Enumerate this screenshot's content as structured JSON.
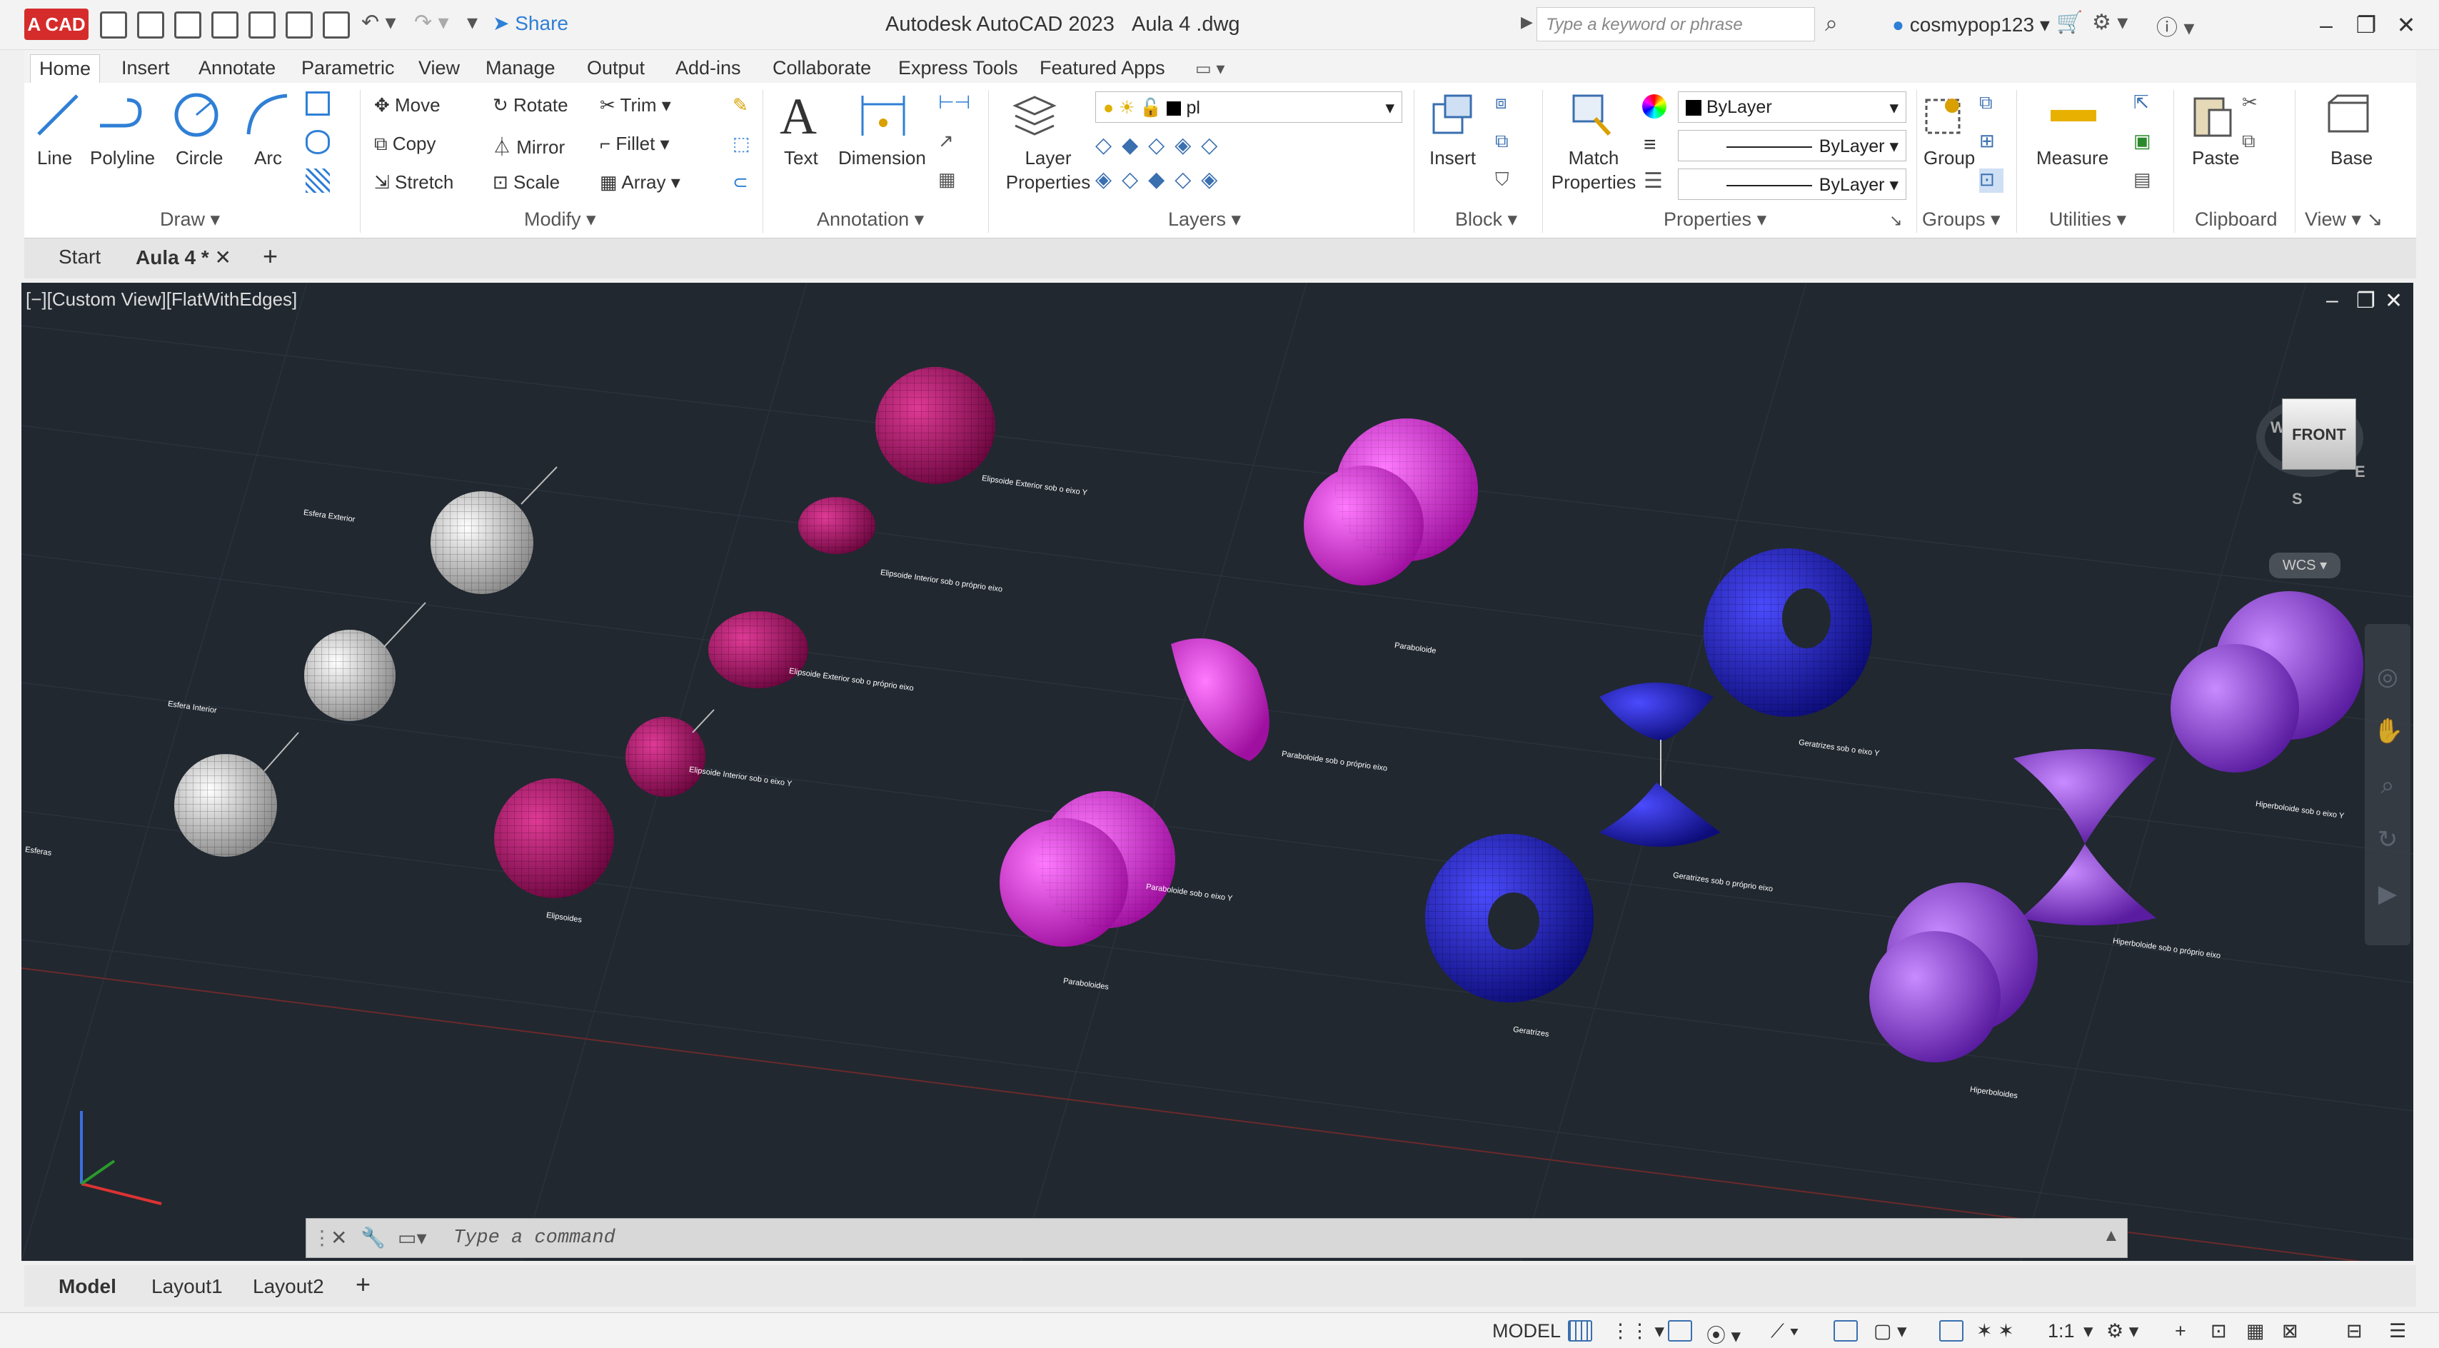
{
  "titlebar": {
    "logo": "A CAD",
    "share": "Share",
    "app_title": "Autodesk AutoCAD 2023",
    "doc_title": "Aula 4 .dwg",
    "search_placeholder": "Type a keyword or phrase",
    "user": "cosmypop123"
  },
  "ribbon_tabs": [
    "Home",
    "Insert",
    "Annotate",
    "Parametric",
    "View",
    "Manage",
    "Output",
    "Add-ins",
    "Collaborate",
    "Express Tools",
    "Featured Apps"
  ],
  "ribbon": {
    "draw": {
      "title": "Draw",
      "line": "Line",
      "polyline": "Polyline",
      "circle": "Circle",
      "arc": "Arc"
    },
    "modify": {
      "title": "Modify",
      "move": "Move",
      "rotate": "Rotate",
      "trim": "Trim",
      "copy": "Copy",
      "mirror": "Mirror",
      "fillet": "Fillet",
      "stretch": "Stretch",
      "scale": "Scale",
      "array": "Array"
    },
    "annotation": {
      "title": "Annotation",
      "text": "Text",
      "dimension": "Dimension"
    },
    "layers": {
      "title": "Layers",
      "layer_properties": "Layer Properties",
      "layer_value": "pl"
    },
    "block": {
      "title": "Block",
      "insert": "Insert"
    },
    "properties": {
      "title": "Properties",
      "match": "Match Properties",
      "color": "ByLayer",
      "linetype": "ByLayer",
      "lineweight": "ByLayer"
    },
    "groups": {
      "title": "Groups",
      "group": "Group"
    },
    "utilities": {
      "title": "Utilities",
      "measure": "Measure"
    },
    "clipboard": {
      "title": "Clipboard",
      "paste": "Paste"
    },
    "view": {
      "title": "View",
      "base": "Base"
    }
  },
  "doc_tabs": {
    "start": "Start",
    "active": "Aula 4 *"
  },
  "viewport": {
    "label": "[−][Custom View][FlatWithEdges]",
    "viewcube": "FRONT",
    "wcs": "WCS",
    "compass_w": "W",
    "compass_e": "E",
    "compass_s": "S",
    "labels": {
      "esfera_exterior": "Esfera Exterior",
      "esfera_interior": "Esfera Interior",
      "esferas": "Esferas",
      "elipsoide_ext_y": "Elipsoide Exterior sob o eixo Y",
      "elipsoide_int_plano": "Elipsoide Interior sob o próprio eixo",
      "elipsoide_ext_plano": "Elipsoide Exterior sob o próprio eixo",
      "elipsoide_int_y": "Elipsoide Interior sob o eixo Y",
      "elipsoides": "Elipsoides",
      "paraboloide": "Paraboloide",
      "paraboloide_plano": "Paraboloide sob o próprio eixo",
      "paraboloide_y": "Paraboloide sob o eixo Y",
      "paraboloides": "Paraboloides",
      "geratrizes_y": "Geratrizes sob o eixo Y",
      "geratrizes_plano": "Geratrizes sob o próprio eixo",
      "geratrizes": "Geratrizes",
      "hiperboloide_y": "Hiperboloide sob o eixo Y",
      "hiperboloide_plano": "Hiperboloide sob o próprio eixo",
      "hiperboloides": "Hiperboloides"
    }
  },
  "command": {
    "placeholder": "Type a command"
  },
  "layout_tabs": [
    "Model",
    "Layout1",
    "Layout2"
  ],
  "status": {
    "model": "MODEL",
    "scale": "1:1"
  },
  "colors": {
    "magenta": "#e020e0",
    "crimson": "#b0106a",
    "blue": "#2020c8",
    "purple": "#8c2fd6",
    "sphere": "#c8c8c8",
    "viewport_bg": "#212830"
  }
}
